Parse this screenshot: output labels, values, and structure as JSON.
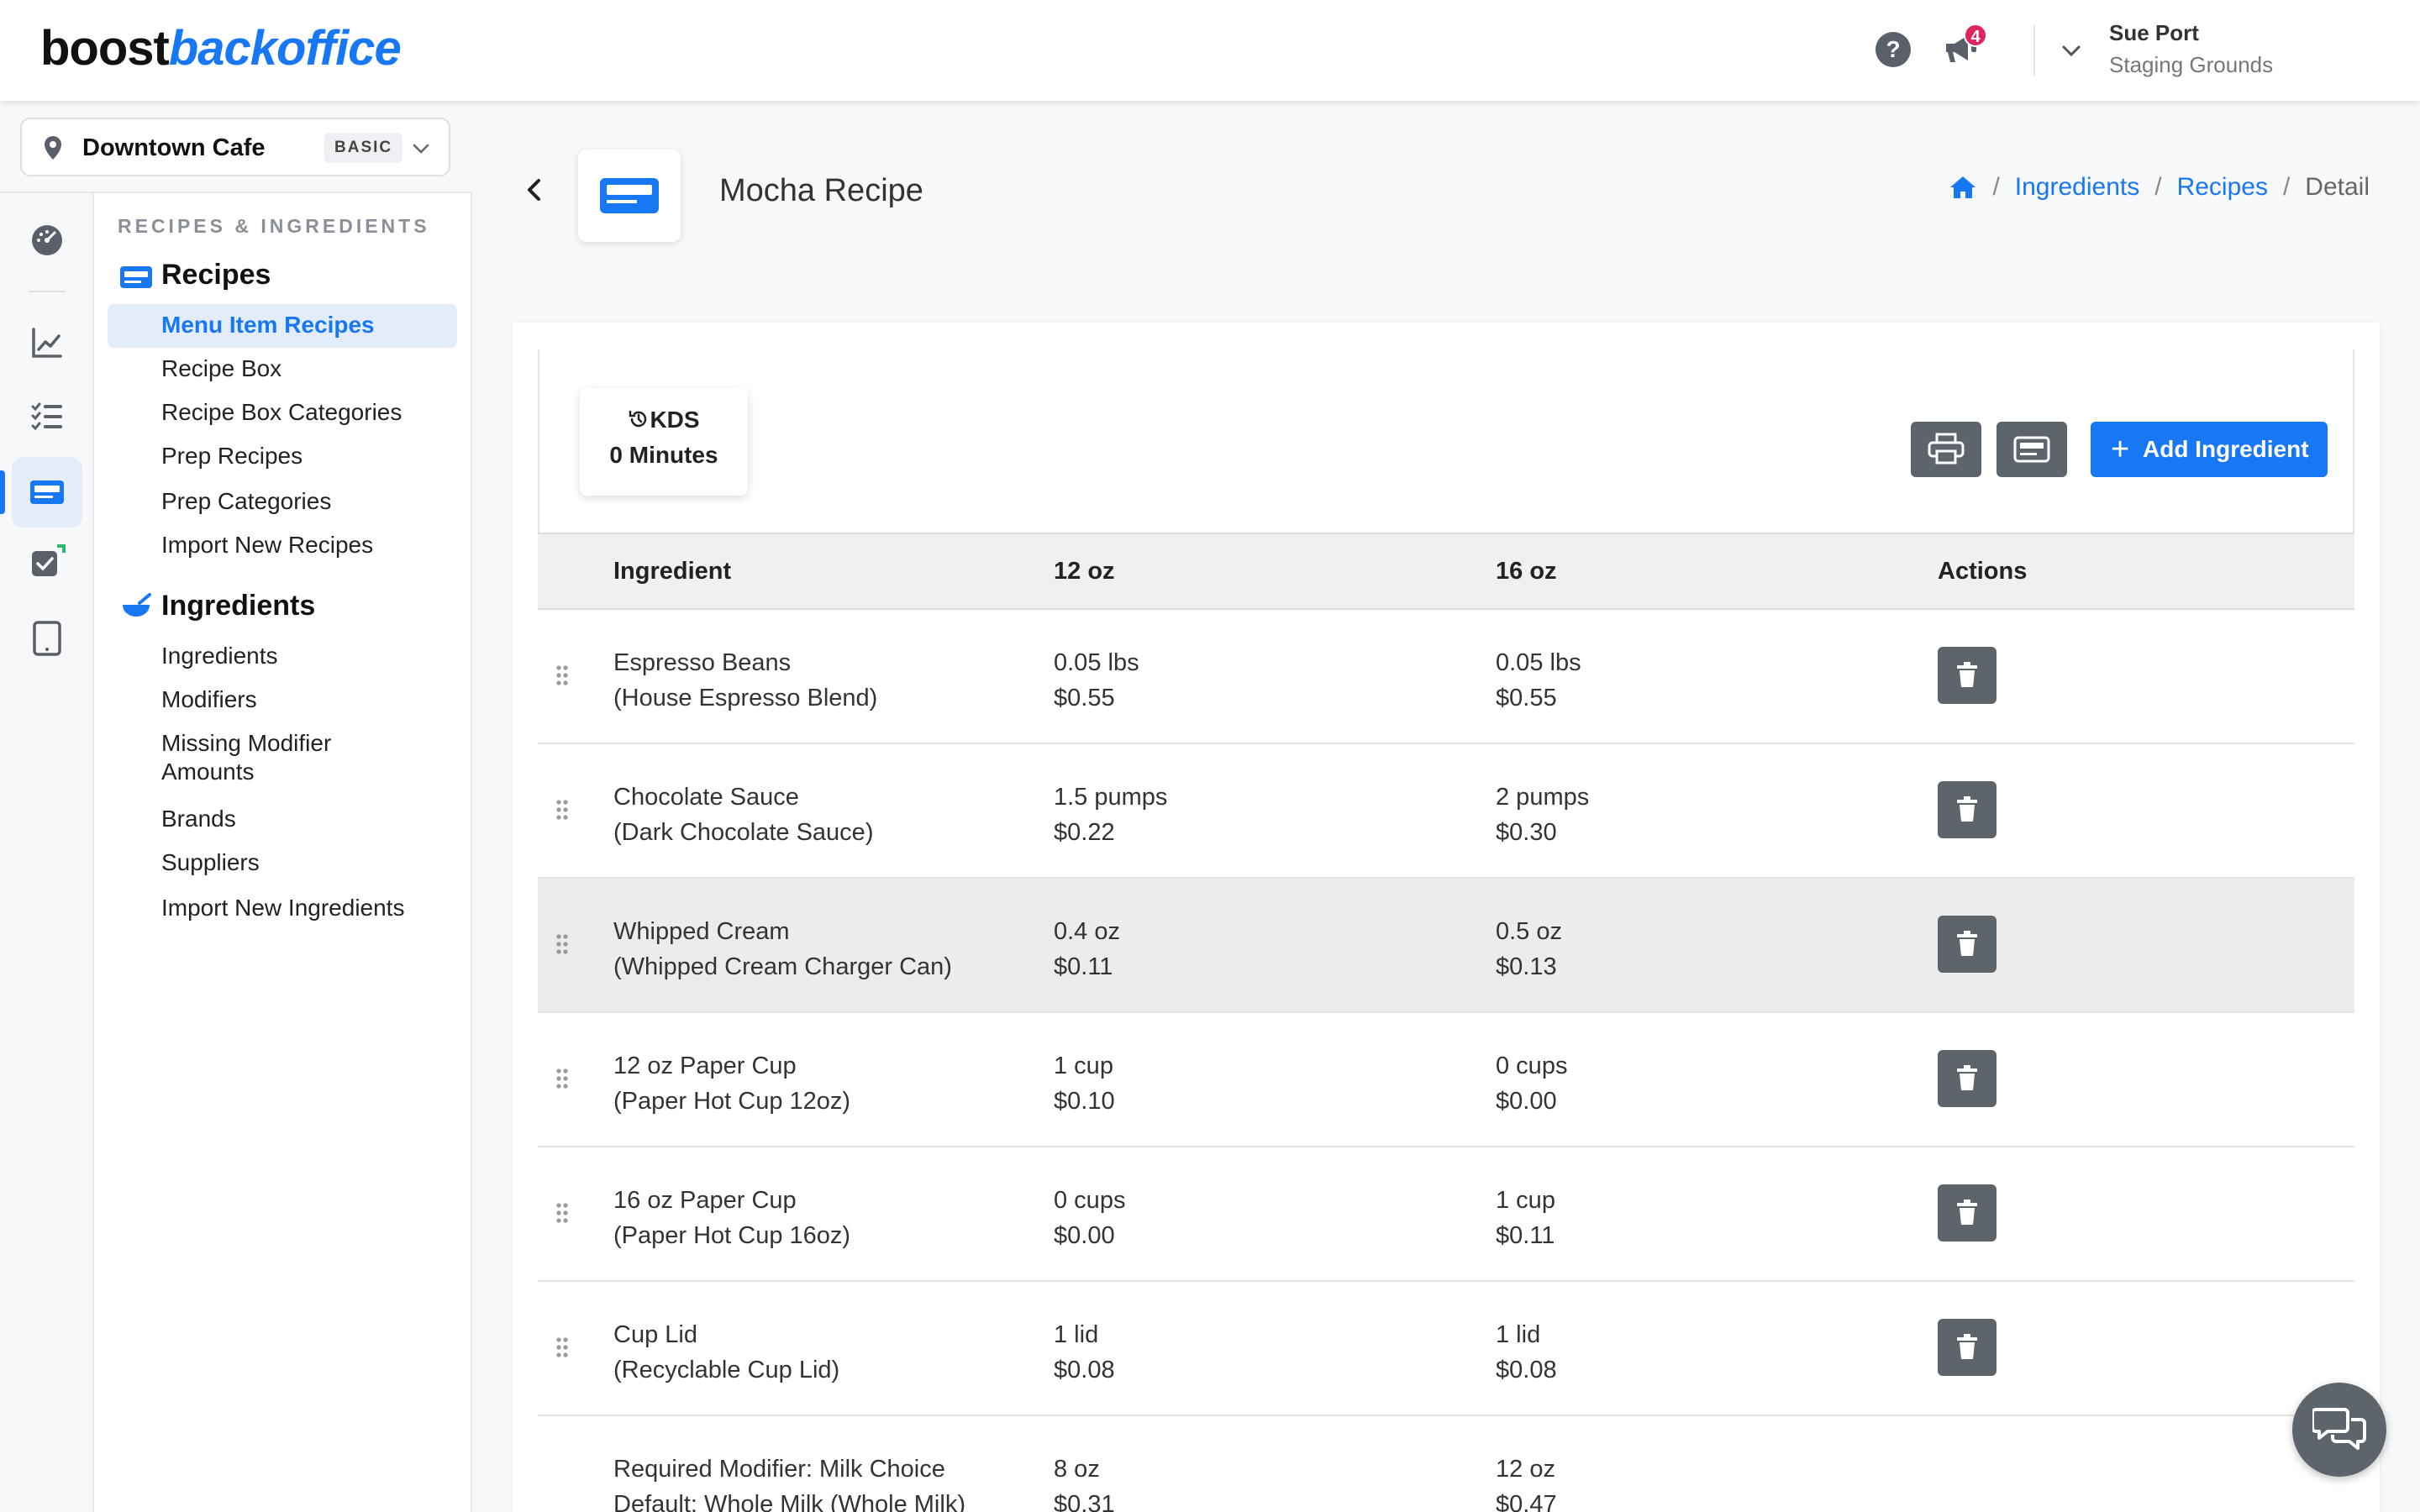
{
  "header": {
    "logo_part1": "boost",
    "logo_part2": "backoffice",
    "help_icon": "help-circle-icon",
    "notification_count": "4",
    "user_name": "Sue Port",
    "user_org": "Staging Grounds"
  },
  "location": {
    "name": "Downtown Cafe",
    "plan_badge": "BASIC"
  },
  "sidebar": {
    "section_label": "RECIPES & INGREDIENTS",
    "groups": [
      {
        "title": "Recipes",
        "items": [
          {
            "label": "Menu Item Recipes",
            "active": true
          },
          {
            "label": "Recipe Box"
          },
          {
            "label": "Recipe Box Categories"
          },
          {
            "label": "Prep Recipes"
          },
          {
            "label": "Prep Categories"
          },
          {
            "label": "Import New Recipes"
          }
        ]
      },
      {
        "title": "Ingredients",
        "items": [
          {
            "label": "Ingredients"
          },
          {
            "label": "Modifiers"
          },
          {
            "label": "Missing Modifier Amounts"
          },
          {
            "label": "Brands"
          },
          {
            "label": "Suppliers"
          },
          {
            "label": "Import New Ingredients"
          }
        ]
      }
    ]
  },
  "page": {
    "title": "Mocha Recipe",
    "breadcrumb": [
      "Ingredients",
      "Recipes",
      "Detail"
    ]
  },
  "kds": {
    "label": "KDS",
    "value": "0 Minutes"
  },
  "toolbar": {
    "add_label": "Add Ingredient"
  },
  "table": {
    "headers": [
      "Ingredient",
      "12 oz",
      "16 oz",
      "Actions"
    ],
    "rows": [
      {
        "name": "Espresso Beans",
        "detail": "(House Espresso Blend)",
        "a_amount": "0.05 lbs",
        "a_cost": "$0.55",
        "b_amount": "0.05 lbs",
        "b_cost": "$0.55"
      },
      {
        "name": "Chocolate Sauce",
        "detail": "(Dark Chocolate Sauce)",
        "a_amount": "1.5 pumps",
        "a_cost": "$0.22",
        "b_amount": "2 pumps",
        "b_cost": "$0.30"
      },
      {
        "name": "Whipped Cream",
        "detail": "(Whipped Cream Charger Can)",
        "a_amount": "0.4 oz",
        "a_cost": "$0.11",
        "b_amount": "0.5 oz",
        "b_cost": "$0.13"
      },
      {
        "name": "12 oz Paper Cup",
        "detail": "(Paper Hot Cup 12oz)",
        "a_amount": "1 cup",
        "a_cost": "$0.10",
        "b_amount": "0 cups",
        "b_cost": "$0.00"
      },
      {
        "name": "16 oz Paper Cup",
        "detail": "(Paper Hot Cup 16oz)",
        "a_amount": "0 cups",
        "a_cost": "$0.00",
        "b_amount": "1 cup",
        "b_cost": "$0.11"
      },
      {
        "name": "Cup Lid",
        "detail": "(Recyclable Cup Lid)",
        "a_amount": "1 lid",
        "a_cost": "$0.08",
        "b_amount": "1 lid",
        "b_cost": "$0.08"
      },
      {
        "name": "Required Modifier: Milk Choice",
        "detail": "Default: Whole Milk (Whole Milk)",
        "a_amount": "8 oz",
        "a_cost": "$0.31",
        "b_amount": "12 oz",
        "b_cost": "$0.47"
      }
    ]
  },
  "colors": {
    "accent": "#1877f2",
    "button_gray": "#5e646c",
    "badge_red": "#e0245e"
  }
}
